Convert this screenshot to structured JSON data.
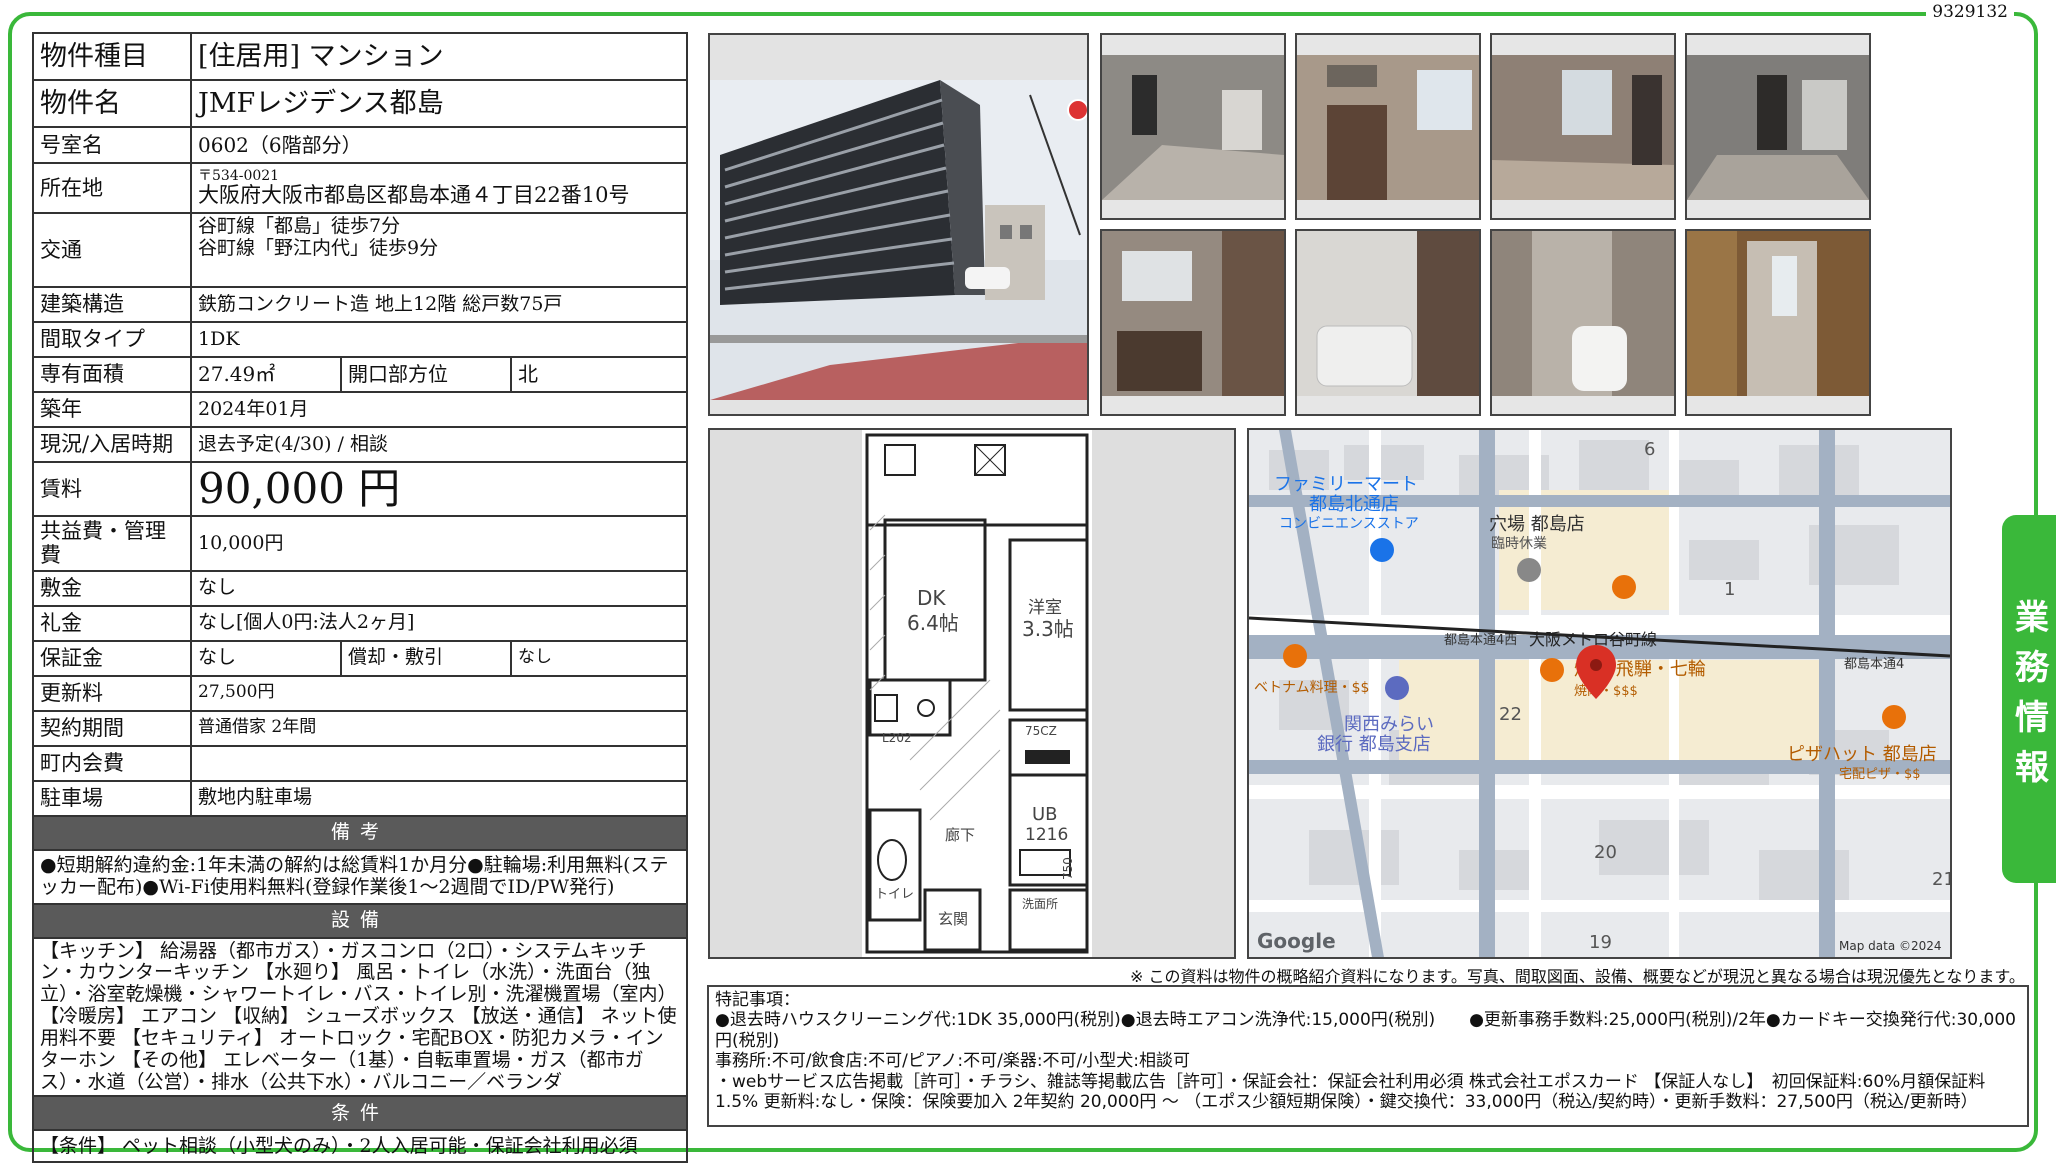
{
  "doc_id": "9329132",
  "side_tab": "業務情報",
  "spec": {
    "type_label": "物件種目",
    "type_value": "[住居用] マンション",
    "name_label": "物件名",
    "name_value": "JMFレジデンス都島",
    "room_label": "号室名",
    "room_value": "0602（6階部分）",
    "addr_label": "所在地",
    "addr_zip": "〒534-0021",
    "addr_value": "大阪府大阪市都島区都島本通４丁目22番10号",
    "access_label": "交通",
    "access_1": "谷町線「都島」徒歩7分",
    "access_2": "谷町線「野江内代」徒歩9分",
    "structure_label": "建築構造",
    "structure_value": "鉄筋コンクリート造 地上12階 総戸数75戸",
    "layout_label": "間取タイプ",
    "layout_value": "1DK",
    "area_label": "専有面積",
    "area_value": "27.49㎡",
    "facing_label": "開口部方位",
    "facing_value": "北",
    "built_label": "築年",
    "built_value": "2024年01月",
    "status_label": "現況/入居時期",
    "status_value": "退去予定(4/30) / 相談",
    "rent_label": "賃料",
    "rent_value": "90,000 円",
    "fee_label": "共益費・管理費",
    "fee_value": "10,000円",
    "deposit_label": "敷金",
    "deposit_value": "なし",
    "keymoney_label": "礼金",
    "keymoney_value": "なし[個人0円:法人2ヶ月]",
    "guarantee_label": "保証金",
    "guarantee_value": "なし",
    "amort_label": "償却・敷引",
    "amort_value": "なし",
    "renewal_label": "更新料",
    "renewal_value": "27,500円",
    "contract_label": "契約期間",
    "contract_value": "普通借家 2年間",
    "community_label": "町内会費",
    "community_value": "",
    "parking_label": "駐車場",
    "parking_value": "敷地内駐車場"
  },
  "remarks_header": "備考",
  "remarks_text": "●短期解約違約金:1年未満の解約は総賃料1か月分●駐輪場:利用無料(ステッカー配布)●Wi-Fi使用料無料(登録作業後1〜2週間でID/PW発行)",
  "equipment_header": "設備",
  "equipment_text": "【キッチン】 給湯器（都市ガス）・ガスコンロ（2口）・システムキッチン・カウンターキッチン 【水廻り】 風呂・トイレ（水洗）・洗面台（独立）・浴室乾燥機・シャワートイレ・バス・トイレ別・洗濯機置場（室内） 【冷暖房】 エアコン 【収納】 シューズボックス 【放送・通信】 ネット使用料不要 【セキュリティ】 オートロック・宅配BOX・防犯カメラ・インターホン 【その他】 エレベーター（1基）・自転車置場・ガス（都市ガス）・水道（公営）・排水（公共下水）・バルコニー／ベランダ",
  "conditions_header": "条件",
  "conditions_text": "【条件】 ペット相談（小型犬のみ）・2人入居可能・保証会社利用必須",
  "floorplan": {
    "dk_label": "DK",
    "dk_size": "6.4帖",
    "bed_label": "洋室",
    "bed_size": "3.3帖",
    "ub_label": "UB",
    "ub_size": "1216",
    "hall_label": "廊下",
    "entry_label": "玄関",
    "toilet_label": "トイレ",
    "wash_label": "洗面所",
    "fridge_label": "L202",
    "closet_label": "75CZ",
    "dim_label": "750"
  },
  "map": {
    "block_6": "6",
    "block_1": "1",
    "block_22": "22",
    "block_20": "20",
    "block_19": "19",
    "block_21": "21",
    "familymart_1": "ファミリーマート",
    "familymart_2": "都島北通店",
    "familymart_3": "コンビニエンスストア",
    "anaba_1": "穴場 都島店",
    "anaba_2": "臨時休業",
    "line_label": "大阪メトロ谷町線",
    "stop_west": "都島本通4西",
    "stop_east": "都島本通4",
    "yakiniku": "焼肉 飛騨・七輪",
    "yakiniku_sub": "焼肉・$$$",
    "vietnam": "ベトナム料理・$$",
    "bank_1": "関西みらい",
    "bank_2": "銀行 都島支店",
    "pizza_1": "ピザハット 都島店",
    "pizza_2": "宅配ピザ・$$",
    "google": "Google",
    "map_data": "Map data ©2024"
  },
  "disclaimer": "※ この資料は物件の概略紹介資料になります。写真、間取図面、設備、概要などが現況と異なる場合は現況優先となります。",
  "special_notes": {
    "title": "特記事項：",
    "line1": "●退去時ハウスクリーニング代:1DK 35,000円(税別)●退去時エアコン洗浄代:15,000円(税別)　　●更新事務手数料:25,000円(税別)/2年●カードキー交換発行代:30,000円(税別)",
    "line2": "事務所:不可/飲食店:不可/ピアノ:不可/楽器:不可/小型犬:相談可",
    "line3": "・webサービス広告掲載［許可］・チラシ、雑誌等掲載広告［許可］・保証会社：保証会社利用必須 株式会社エポスカード 【保証人なし】　初回保証料:60%月額保証料1.5% 更新料:なし・保険：保険要加入 2年契約 20,000円 〜 （エポス少額短期保険）・鍵交換代：33,000円（税込/契約時）・更新手数料：27,500円（税込/更新時）"
  }
}
